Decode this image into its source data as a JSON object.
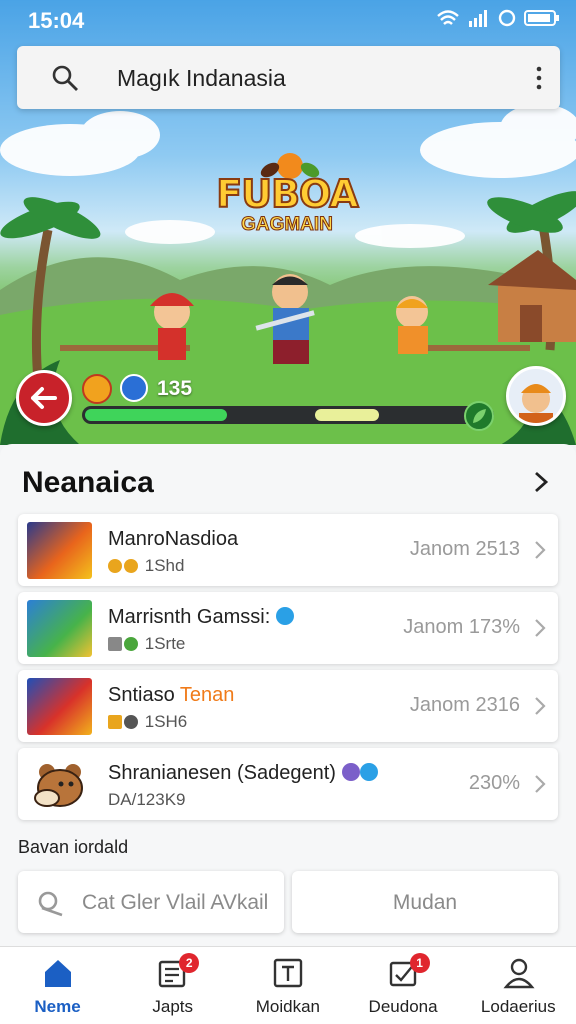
{
  "status_bar": {
    "time": "15:04"
  },
  "search": {
    "query": "Magık Indanasia"
  },
  "hero": {
    "logo_line1": "FUBOA",
    "logo_line2": "GAGMAIN",
    "score": "135"
  },
  "section": {
    "title": "Neanaica",
    "items": [
      {
        "title": "ManroNasdioa",
        "subtitle": "1Shd",
        "right": "Janom 2513"
      },
      {
        "title": "Marrisnth Gamssi:",
        "subtitle": "1Srte",
        "right": "Janom 173%"
      },
      {
        "title": "Sntiaso",
        "title_accent": "Tenan",
        "subtitle": "1SH6",
        "right": "Janom 2316"
      },
      {
        "title": "Shranianesen (Sadegent)",
        "subtitle": "DA/123K9",
        "right": "230%"
      }
    ],
    "footer_label": "Bavan iordald"
  },
  "buttons": {
    "primary": "Cat Gler Vlail AVkail",
    "secondary": "Mudan"
  },
  "nav": [
    {
      "label": "Neme",
      "badge": ""
    },
    {
      "label": "Japts",
      "badge": "2"
    },
    {
      "label": "Moidkan",
      "badge": ""
    },
    {
      "label": "Deudona",
      "badge": "1"
    },
    {
      "label": "Lodaerius",
      "badge": ""
    }
  ],
  "colors": {
    "accent": "#1b5fc4",
    "back_button": "#c8222a",
    "progress_green": "#3fd45a",
    "badge_red": "#e0262e",
    "subtitle_orange": "#f07b1a"
  },
  "progress": {
    "level": 0.35
  }
}
